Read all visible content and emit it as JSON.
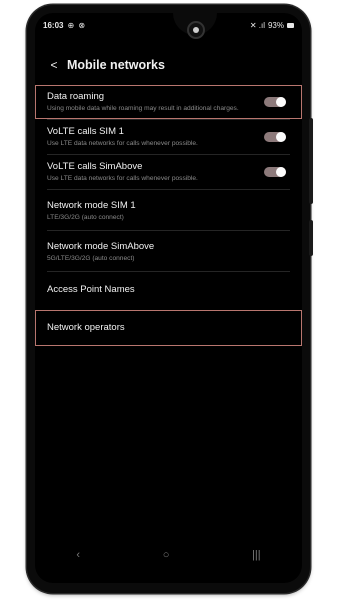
{
  "status": {
    "time": "16:03",
    "left_icons": "⊕ ⊗",
    "right_icons": "✕ .ıl",
    "battery": "93%"
  },
  "header": {
    "back_icon": "chevron-left",
    "title": "Mobile networks"
  },
  "items": [
    {
      "label": "Data roaming",
      "sub": "Using mobile data while roaming may result in additional charges."
    },
    {
      "label": "VoLTE calls SIM 1",
      "sub": "Use LTE data networks for calls whenever possible."
    },
    {
      "label": "VoLTE calls SimAbove",
      "sub": "Use LTE data networks for calls whenever possible."
    },
    {
      "label": "Network mode SIM 1",
      "sub": "LTE/3G/2G (auto connect)"
    },
    {
      "label": "Network mode SimAbove",
      "sub": "5G/LTE/3G/2G (auto connect)"
    },
    {
      "label": "Access Point Names"
    },
    {
      "label": "Network operators"
    }
  ],
  "navbar": {
    "back": "‹",
    "home": "○",
    "recents": "|||"
  },
  "colors": {
    "highlight": "#b9766f",
    "toggle_track": "#8d7a7b"
  }
}
